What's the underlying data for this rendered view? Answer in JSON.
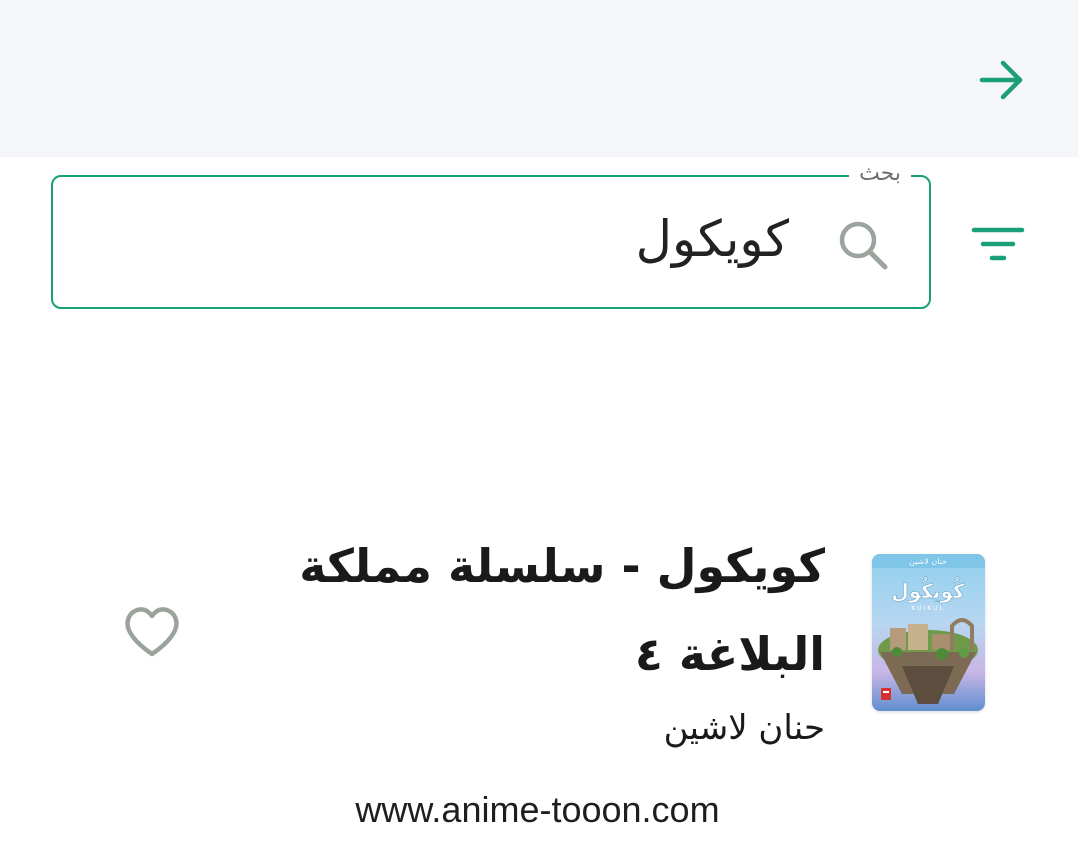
{
  "header": {
    "back_icon": "arrow-right-icon",
    "accent_color": "#1aa079"
  },
  "search": {
    "label": "بحث",
    "value": "كويكول",
    "icon": "search-icon",
    "filter_icon": "filter-icon",
    "border_color": "#1aa079"
  },
  "results": [
    {
      "title": "كويكول - سلسلة مملكة البلاغة ٤",
      "author": "حنان لاشين",
      "cover_title": "كُويكُول",
      "cover_subtitle": "KUIKUL",
      "favorite_icon": "heart-outline-icon"
    }
  ],
  "watermark": {
    "text": "www.anime-tooon.com"
  }
}
